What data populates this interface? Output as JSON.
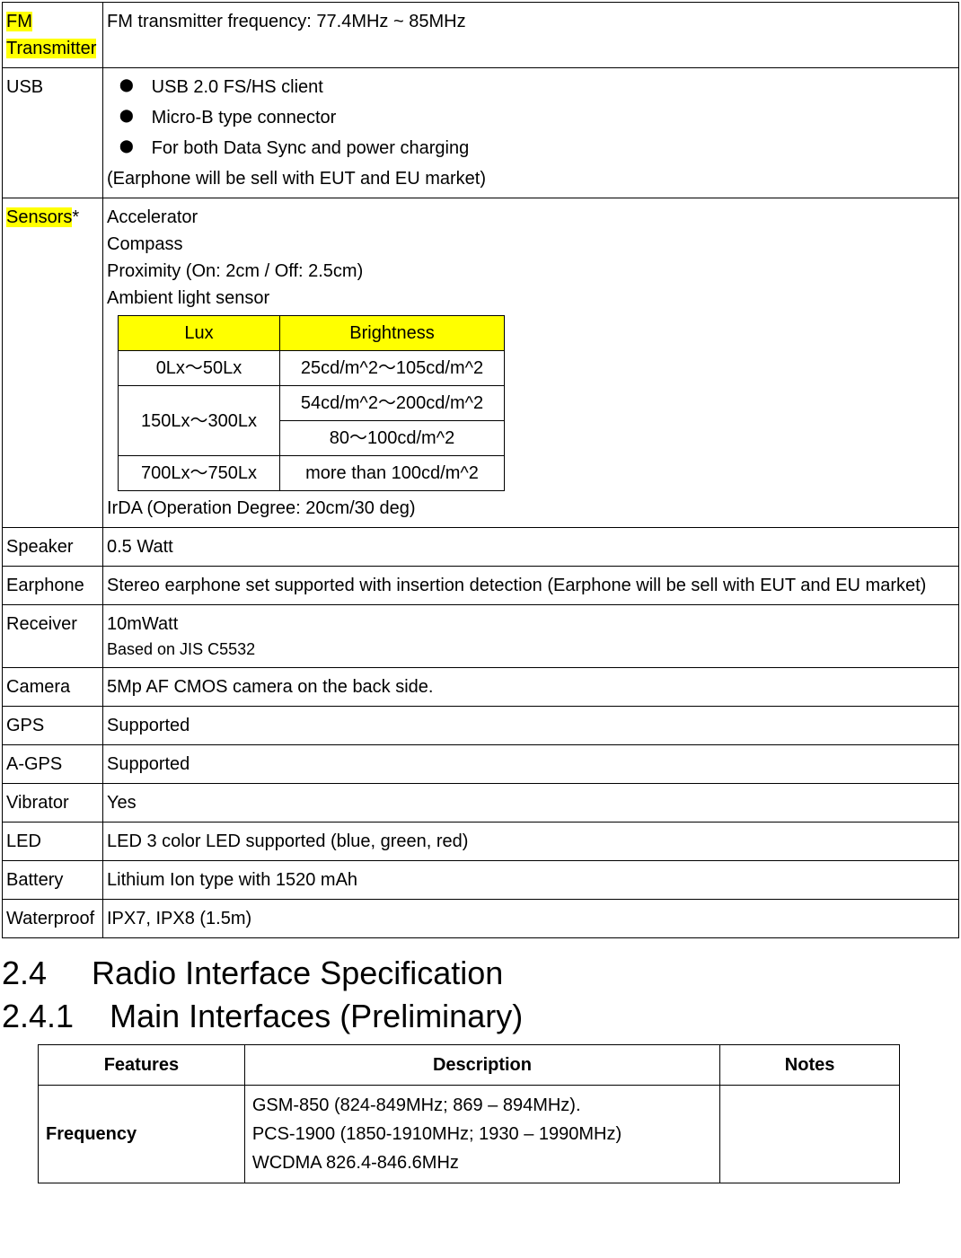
{
  "specs": {
    "fm": {
      "label": "FM Transmitter",
      "label_a": "FM ",
      "label_b": "Transmitter",
      "value": "FM transmitter frequency:    77.4MHz ~ 85MHz"
    },
    "usb": {
      "label": "USB",
      "bullets": {
        "b1": "USB 2.0 FS/HS client",
        "b2": "Micro-B type connector",
        "b3": "For both Data Sync and power charging"
      },
      "note": "(Earphone will be sell with EUT and EU market)"
    },
    "sensors": {
      "label_hl": "Sensors",
      "label_star": "*",
      "lines": {
        "accel": "Accelerator",
        "compass": "Compass",
        "prox": "Proximity (On: 2cm / Off: 2.5cm)",
        "ambient": "Ambient light sensor"
      },
      "lux": {
        "head_lux": "Lux",
        "head_bright": "Brightness",
        "r1_lux": "0Lx～50Lx",
        "r1_bright": "25cd/m^2～105cd/m^2",
        "r2_lux": "150Lx～300Lx",
        "r2_bright_a": "54cd/m^2～200cd/m^2",
        "r2_bright_b": "80～100cd/m^2",
        "r3_lux": "700Lx～750Lx",
        "r3_bright": "more than 100cd/m^2"
      },
      "irda": "IrDA (Operation Degree: 20cm/30 deg)"
    },
    "speaker": {
      "label": "Speaker",
      "value": "0.5 Watt"
    },
    "earphone": {
      "label": "Earphone",
      "value": "Stereo earphone set supported with insertion detection (Earphone will be sell with EUT and EU market)"
    },
    "receiver": {
      "label": "Receiver",
      "value": "10mWatt",
      "note": "Based on JIS C5532"
    },
    "camera": {
      "label": "Camera",
      "value": "5Mp AF CMOS camera on the back side."
    },
    "gps": {
      "label": "GPS",
      "value": "Supported"
    },
    "agps": {
      "label": "A-GPS",
      "value": "Supported"
    },
    "vibrator": {
      "label": "Vibrator",
      "value": "Yes"
    },
    "led": {
      "label": "LED",
      "value": "LED 3 color LED supported (blue, green, red)"
    },
    "battery": {
      "label": "Battery",
      "value": "Lithium Ion type with 1520 mAh"
    },
    "waterproof": {
      "label": "Waterproof",
      "value": "IPX7, IPX8 (1.5m)"
    }
  },
  "headings": {
    "h24": "2.4     Radio Interface Specification",
    "h241": "2.4.1    Main Interfaces (Preliminary)"
  },
  "radio": {
    "head": {
      "features": "Features",
      "desc": "Description",
      "notes": "Notes"
    },
    "freq": {
      "label": "Frequency",
      "l1": "GSM-850 (824-849MHz; 869 – 894MHz).",
      "l2": "PCS-1900 (1850-1910MHz; 1930 – 1990MHz)",
      "l3": "WCDMA 826.4-846.6MHz",
      "notes": ""
    }
  }
}
